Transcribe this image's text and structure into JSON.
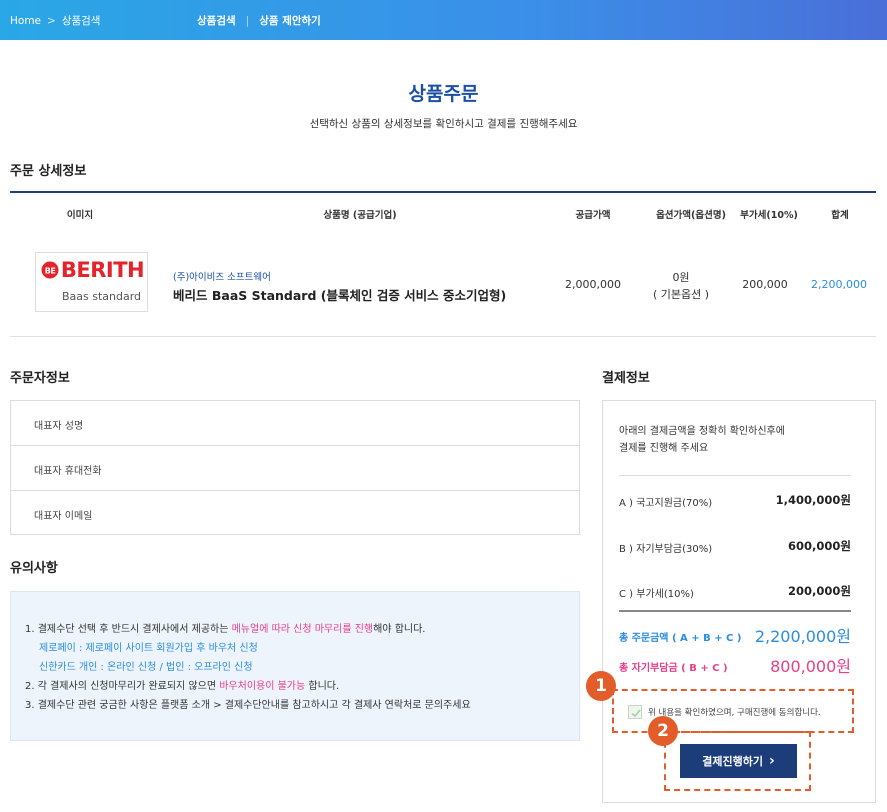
{
  "topbar": {
    "home": "Home",
    "crumb_sep": ">",
    "crumb_current": "상품검색",
    "tab_search": "상품검색",
    "tab_divider": "|",
    "tab_propose": "상품 제안하기"
  },
  "page": {
    "title": "상품주문",
    "subtitle": "선택하신 상품의 상세정보를 확인하시고 결제를 진행해주세요"
  },
  "order_detail": {
    "section_title": "주문 상세정보",
    "columns": [
      "이미지",
      "상품명 (공급기업)",
      "공급가액",
      "옵션가액(옵션명)",
      "부가세(10%)",
      "합계"
    ],
    "item": {
      "logo_text": "BERITH",
      "logo_sub": "Baas standard",
      "vendor": "(주)아이비즈 소프트웨어",
      "name": "베리드 BaaS Standard (블록체인 검증 서비스 중소기업형)",
      "supply": "2,000,000",
      "option_price": "0원",
      "option_name": "( 기본옵션 )",
      "vat": "200,000",
      "total": "2,200,000"
    }
  },
  "orderer": {
    "section_title": "주문자정보",
    "fields": [
      "대표자 성명",
      "대표자 휴대전화",
      "대표자 이메일"
    ]
  },
  "notice": {
    "section_title": "유의사항",
    "l1_a": "1. 결제수단 선택 후 반드시 결제사에서 제공하는 ",
    "l1_b": "메뉴얼에 따라 신청 마무리를 진행",
    "l1_c": "해야 합니다.",
    "l2": "제로페이 : 제로페이 사이트 회원가입 후 바우처 신청",
    "l3": "신한카드 개인 : 온라인 신청 / 법인 : 오프라인 신청",
    "l4_a": "2. 각 결제사의 신청마무리가 완료되지 않으면 ",
    "l4_b": "바우처이용이 불가능",
    "l4_c": " 합니다.",
    "l5": "3. 결제수단 관련 궁금한 사항은 플랫폼 소개 > 결제수단안내를 참고하시고 각 결제사 연락처로 문의주세요"
  },
  "payment": {
    "section_title": "결제정보",
    "intro_1": "아래의 결제금액을 정확히 확인하신후에",
    "intro_2": "결제를 진행해 주세요",
    "a_label": "A ) 국고지원금(70%)",
    "a_value": "1,400,000원",
    "b_label": "B ) 자기부담금(30%)",
    "b_value": "600,000원",
    "c_label": "C ) 부가세(10%)",
    "c_value": "200,000원",
    "total_label": "총 주문금액 ( A + B + C )",
    "total_value": "2,200,000원",
    "self_label": "총 자기부담금 ( B + C )",
    "self_value": "800,000원",
    "agree_text": "위 내용을 확인하였으며, 구매진행에 동의합니다.",
    "button": "결제진행하기",
    "button_arrow": "›"
  },
  "markers": [
    "1",
    "2"
  ],
  "colors": {
    "accent": "#1c3d7a",
    "highlight": "#e35d2b",
    "pink": "#e8408a",
    "blue": "#2a8de0"
  }
}
